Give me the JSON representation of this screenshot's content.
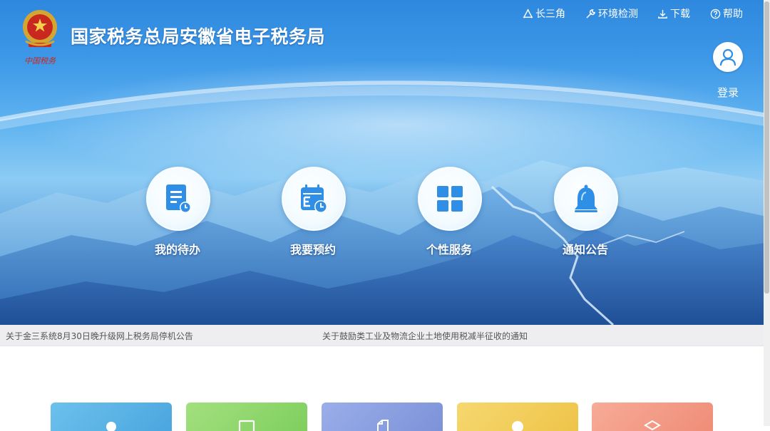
{
  "header": {
    "site_title": "国家税务总局安徽省电子税务局",
    "emblem_caption": "中国税务"
  },
  "topnav": [
    {
      "label": "长三角",
      "icon": "triangle-icon"
    },
    {
      "label": "环境检测",
      "icon": "wrench-icon"
    },
    {
      "label": "下载",
      "icon": "download-icon"
    },
    {
      "label": "帮助",
      "icon": "help-icon"
    }
  ],
  "login": {
    "label": "登录",
    "icon": "user-icon"
  },
  "features": [
    {
      "label": "我的待办",
      "icon": "todo-document-icon"
    },
    {
      "label": "我要预约",
      "icon": "calendar-clock-icon"
    },
    {
      "label": "个性服务",
      "icon": "grid-icon"
    },
    {
      "label": "通知公告",
      "icon": "bell-icon"
    }
  ],
  "notices": [
    "关于金三系统8月30日晚升级网上税务局停机公告",
    "关于鼓励类工业及物流企业土地使用税减半征收的通知"
  ],
  "cards": [
    {
      "color": "#5ab3e4",
      "icon": "person-icon"
    },
    {
      "color": "#8fd66e",
      "icon": "monitor-icon"
    },
    {
      "color": "#8a9fe0",
      "icon": "document-icon"
    },
    {
      "color": "#f2cf5a",
      "icon": "circle-icon"
    },
    {
      "color": "#f39a86",
      "icon": "layers-icon"
    }
  ],
  "colors": {
    "hero_top": "#2e88de",
    "feature_icon": "#2f8fe6",
    "notice_bar": "#eeeef0"
  }
}
